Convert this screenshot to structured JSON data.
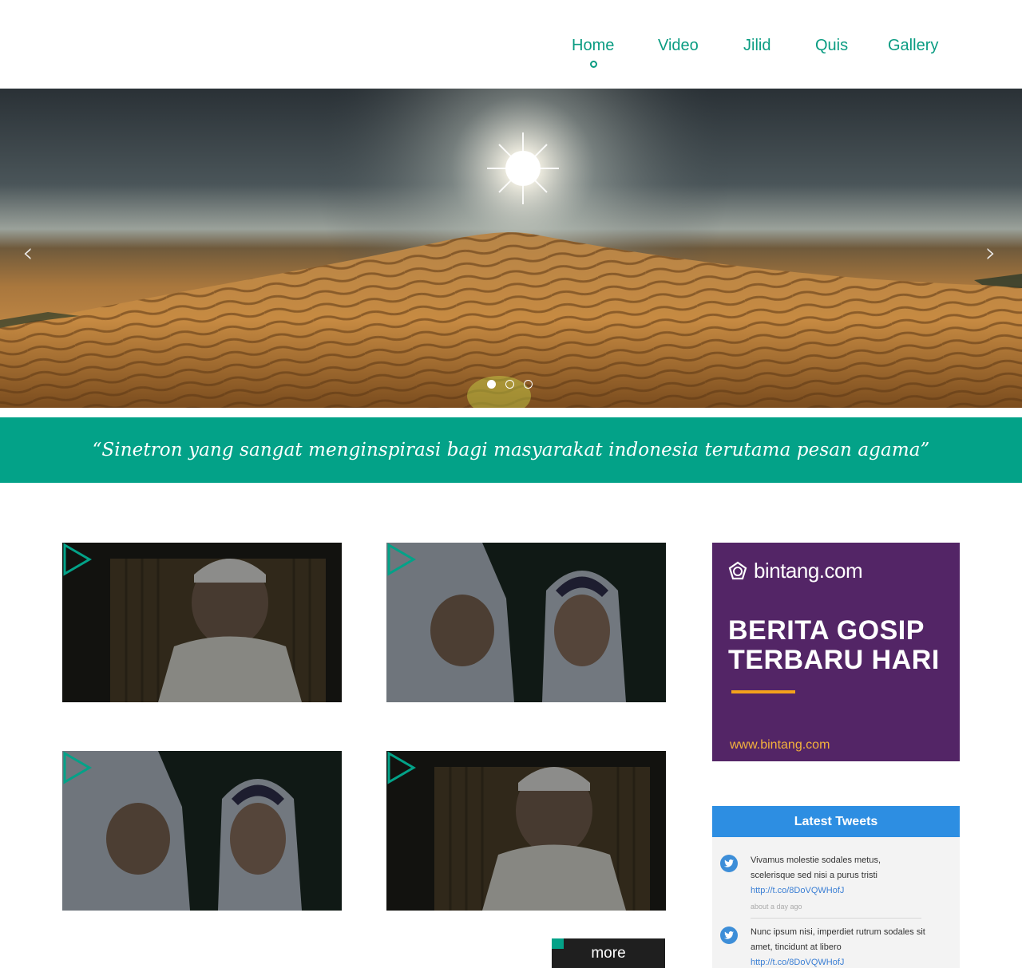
{
  "nav": {
    "items": [
      {
        "label": "Home"
      },
      {
        "label": "Video"
      },
      {
        "label": "Jilid"
      },
      {
        "label": "Quis"
      },
      {
        "label": "Gallery"
      }
    ],
    "active": "Home"
  },
  "hero": {
    "slides_count": 3,
    "active_slide": 1,
    "prev_icon": "chevron-left-icon",
    "next_icon": "chevron-right-icon"
  },
  "quote": {
    "text": "“Sinetron yang sangat menginspirasi bagi masyarakat indonesia terutama pesan agama”"
  },
  "videos": {
    "play_icon": "play-icon",
    "accent_color": "#03a288",
    "more_label": "more"
  },
  "ad": {
    "brand": "bintang.com",
    "headline_line1": "BERITA GOSIP",
    "headline_line2": "TERBARU HARI",
    "url": "www.bintang.com",
    "background": "#532566"
  },
  "tweets": {
    "title": "Latest Tweets",
    "items": [
      {
        "text": "Vivamus molestie sodales metus, scelerisque sed nisi a purus tristi",
        "link": "http://t.co/8DoVQWHofJ",
        "time": "about a day ago"
      },
      {
        "text": "Nunc ipsum nisi, imperdiet rutrum sodales sit amet, tincidunt at libero",
        "link": "http://t.co/8DoVQWHofJ"
      }
    ]
  }
}
